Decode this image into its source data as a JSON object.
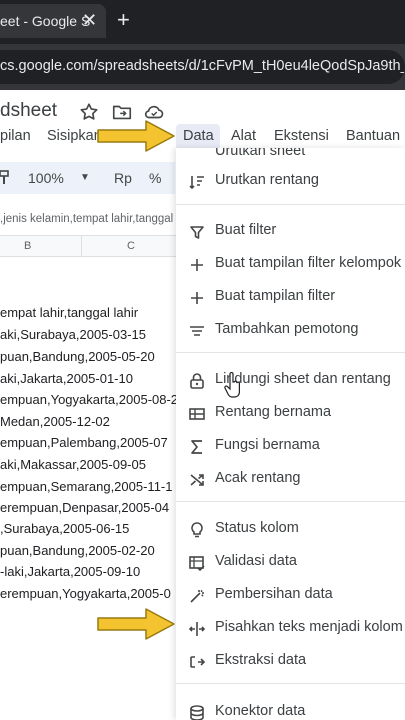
{
  "browser": {
    "tab_title": "eet - Google S",
    "tab_close": "✕",
    "new_tab": "+",
    "url": "cs.google.com/spreadsheets/d/1cFvPM_tH0eu4leQodSpJa9th_j"
  },
  "sheets": {
    "doc_title": "dsheet",
    "menu": {
      "items_left": [
        "pilan",
        "Sisipkan"
      ],
      "data": "Data",
      "alat": "Alat",
      "ekstensi": "Ekstensi",
      "bantuan": "Bantuan"
    },
    "toolbar": {
      "zoom": "100%",
      "currency": "Rp",
      "percent": "%"
    },
    "formula_text": ",jenis kelamin,tempat lahir,tanggal",
    "columns": [
      "B",
      "C"
    ],
    "rows": [
      "empat lahir,tanggal lahir",
      "aki,Surabaya,2005-03-15",
      "puan,Bandung,2005-05-20",
      "aki,Jakarta,2005-01-10",
      "empuan,Yogyakarta,2005-08-2",
      "Medan,2005-12-02",
      "empuan,Palembang,2005-07",
      "aki,Makassar,2005-09-05",
      "empuan,Semarang,2005-11-1",
      "erempuan,Denpasar,2005-04",
      ",Surabaya,2005-06-15",
      "puan,Bandung,2005-02-20",
      "-laki,Jakarta,2005-09-10",
      "erempuan,Yogyakarta,2005-0"
    ]
  },
  "data_menu": {
    "partial_top": "Urutkan sheet",
    "sort_range": "Urutkan rentang",
    "create_filter": "Buat filter",
    "create_group_filter_view": "Buat tampilan filter kelompok",
    "create_filter_view": "Buat tampilan filter",
    "add_slicer": "Tambahkan pemotong",
    "protect": "Lindungi sheet dan rentang",
    "named_ranges": "Rentang bernama",
    "named_functions": "Fungsi bernama",
    "random_range": "Acak rentang",
    "column_stats": "Status kolom",
    "data_validation": "Validasi data",
    "data_cleanup": "Pembersihan data",
    "split_text": "Pisahkan teks menjadi kolom",
    "data_extraction": "Ekstraksi data",
    "data_connectors": "Konektor data"
  },
  "colors": {
    "annotation_arrow": "#f4c430",
    "chrome_dark": "#202124",
    "menu_text": "#3c4043"
  }
}
